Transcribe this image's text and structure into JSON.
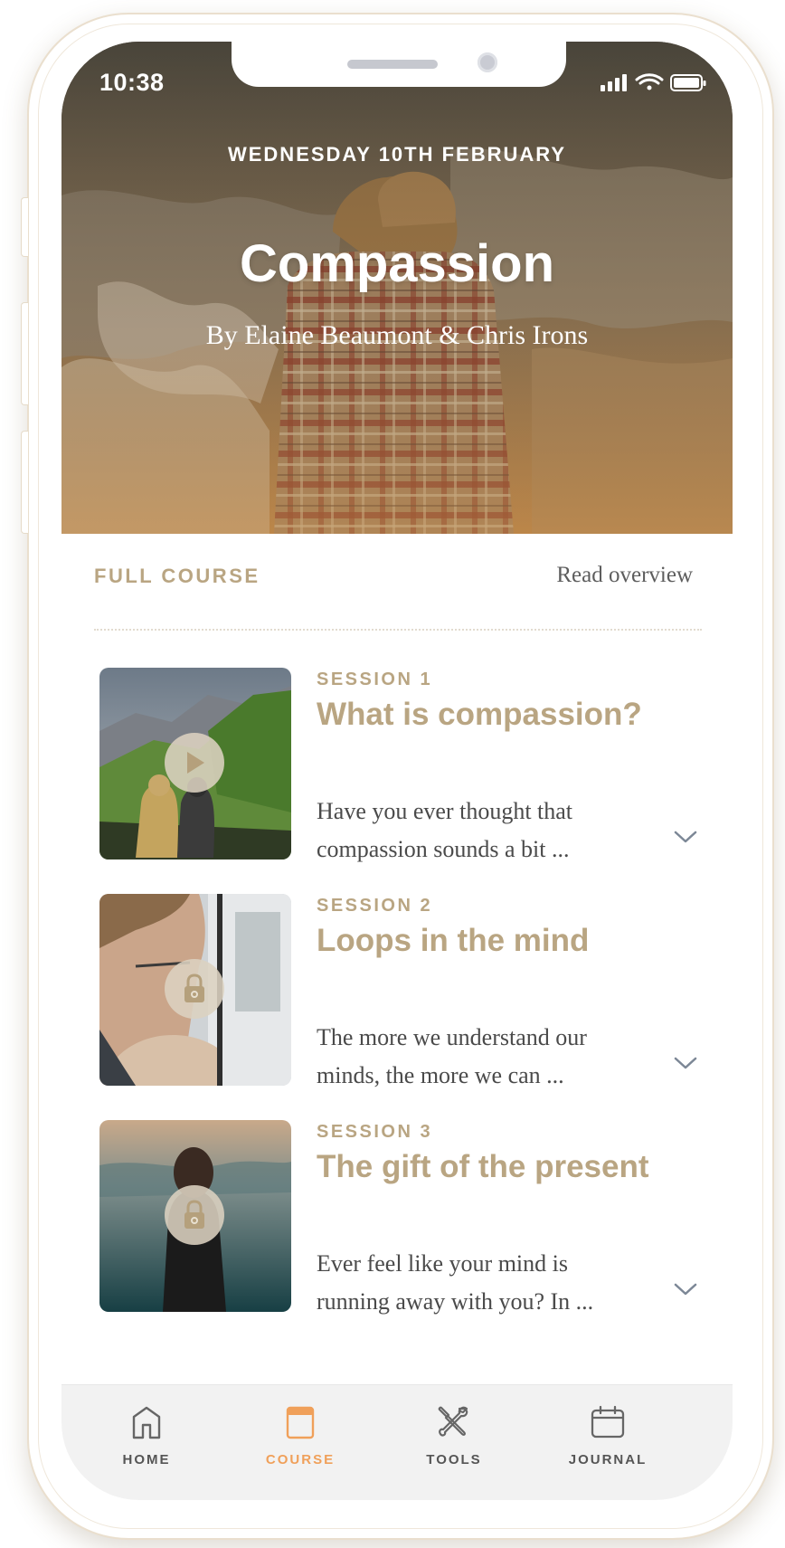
{
  "status_bar": {
    "time": "10:38"
  },
  "hero": {
    "date": "WEDNESDAY 10TH FEBRUARY",
    "title": "Compassion",
    "authors": "By Elaine Beaumont & Chris Irons"
  },
  "course": {
    "label": "FULL COURSE",
    "overview_link": "Read overview"
  },
  "sessions": [
    {
      "number": "SESSION 1",
      "title": "What is compassion?",
      "desc_line1": "Have you ever thought that",
      "desc_line2": "compassion sounds a bit ...",
      "state": "play"
    },
    {
      "number": "SESSION 2",
      "title": "Loops in the mind",
      "desc_line1": "The more we understand our",
      "desc_line2": "minds, the more we can ...",
      "state": "locked"
    },
    {
      "number": "SESSION 3",
      "title": "The gift of the present",
      "desc_line1": "Ever feel like your mind is",
      "desc_line2": "running away with you? In ...",
      "state": "locked"
    }
  ],
  "tabs": [
    {
      "label": "HOME",
      "icon": "home-icon",
      "active": false
    },
    {
      "label": "COURSE",
      "icon": "course-icon",
      "active": true
    },
    {
      "label": "TOOLS",
      "icon": "tools-icon",
      "active": false
    },
    {
      "label": "JOURNAL",
      "icon": "journal-icon",
      "active": false
    }
  ],
  "colors": {
    "accent": "#b9a582",
    "active_tab": "#f0a05a",
    "body_text": "#4a4a4a"
  }
}
